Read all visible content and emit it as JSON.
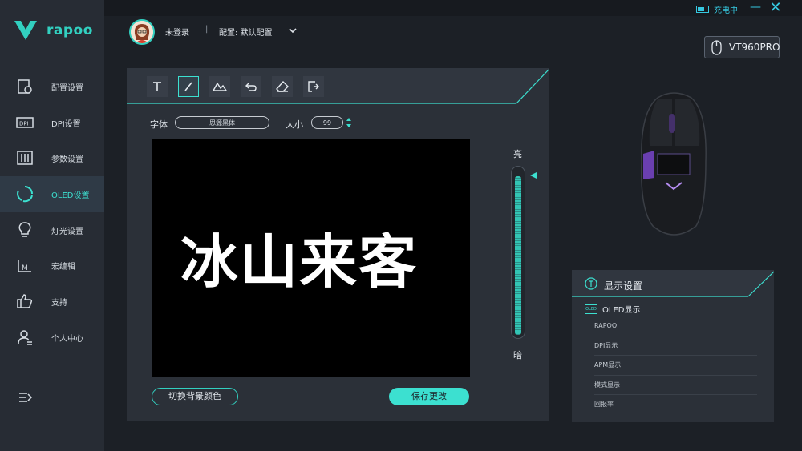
{
  "app": {
    "logo_text": "rapoo",
    "charging": "充电中",
    "minimize": "—",
    "close": "✕"
  },
  "sidebar": {
    "items": [
      {
        "label": "配置设置",
        "icon": "config-icon"
      },
      {
        "label": "DPI设置",
        "icon": "dpi-icon"
      },
      {
        "label": "参数设置",
        "icon": "sliders-icon"
      },
      {
        "label": "OLED设置",
        "icon": "oled-icon",
        "active": true
      },
      {
        "label": "灯光设置",
        "icon": "bulb-icon"
      },
      {
        "label": "宏编辑",
        "icon": "macro-icon"
      },
      {
        "label": "支持",
        "icon": "thumbs-up-icon"
      },
      {
        "label": "个人中心",
        "icon": "user-icon"
      }
    ]
  },
  "header": {
    "user_status": "未登录",
    "separator": "|",
    "config_label": "配置: 默认配置",
    "device": "VT960PRO"
  },
  "editor": {
    "tools": [
      "text-tool",
      "pen-tool",
      "image-tool",
      "undo-tool",
      "eraser-tool",
      "export-tool"
    ],
    "font_label": "字体",
    "font_value": "思源黑体",
    "size_label": "大小",
    "size_value": "99",
    "canvas_text": "冰山来客",
    "brightness_high": "亮",
    "brightness_low": "暗",
    "brightness_level": 0.96,
    "switch_bg_label": "切换背景颜色",
    "save_label": "保存更改"
  },
  "display_settings": {
    "title": "显示设置",
    "section": "OLED显示",
    "section_icon_text": "OLED",
    "items": [
      "RAPOO",
      "DPI显示",
      "APM显示",
      "模式显示",
      "回报率"
    ]
  },
  "colors": {
    "accent": "#3ce0d0",
    "sidebar_bg": "#272c34",
    "panel_bg": "#2b3038"
  }
}
